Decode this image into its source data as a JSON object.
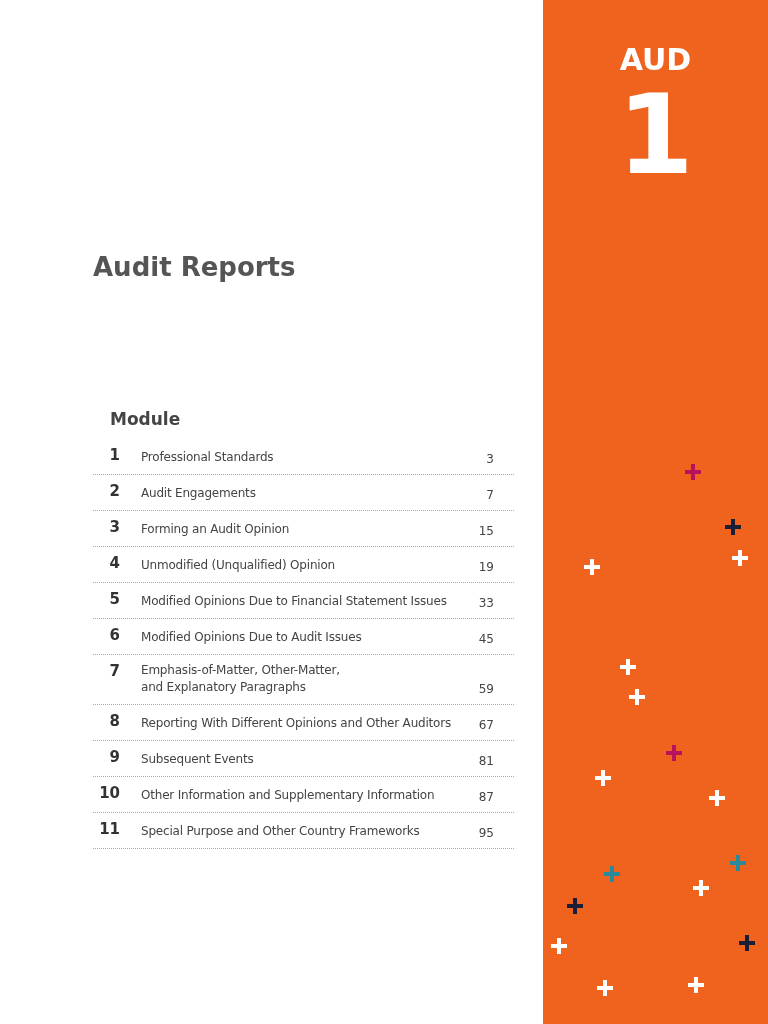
{
  "subject": "AUD",
  "section_number": "1",
  "title": "Audit Reports",
  "module_heading": "Module",
  "modules": [
    {
      "number": "1",
      "title": "Professional Standards",
      "page": "3"
    },
    {
      "number": "2",
      "title": "Audit Engagements",
      "page": "7"
    },
    {
      "number": "3",
      "title": "Forming an Audit Opinion",
      "page": "15"
    },
    {
      "number": "4",
      "title": "Unmodified (Unqualified) Opinion",
      "page": "19"
    },
    {
      "number": "5",
      "title": "Modified Opinions Due to Financial Statement Issues",
      "page": "33"
    },
    {
      "number": "6",
      "title": "Modified Opinions Due to Audit Issues",
      "page": "45"
    },
    {
      "number": "7",
      "title": "Emphasis-of-Matter, Other-Matter,\nand Explanatory Paragraphs",
      "page": "59"
    },
    {
      "number": "8",
      "title": "Reporting With Different Opinions and Other Auditors",
      "page": "67"
    },
    {
      "number": "9",
      "title": "Subsequent Events",
      "page": "81"
    },
    {
      "number": "10",
      "title": "Other Information and Supplementary Information",
      "page": "87"
    },
    {
      "number": "11",
      "title": "Special Purpose and Other Country Frameworks",
      "page": "95"
    }
  ]
}
